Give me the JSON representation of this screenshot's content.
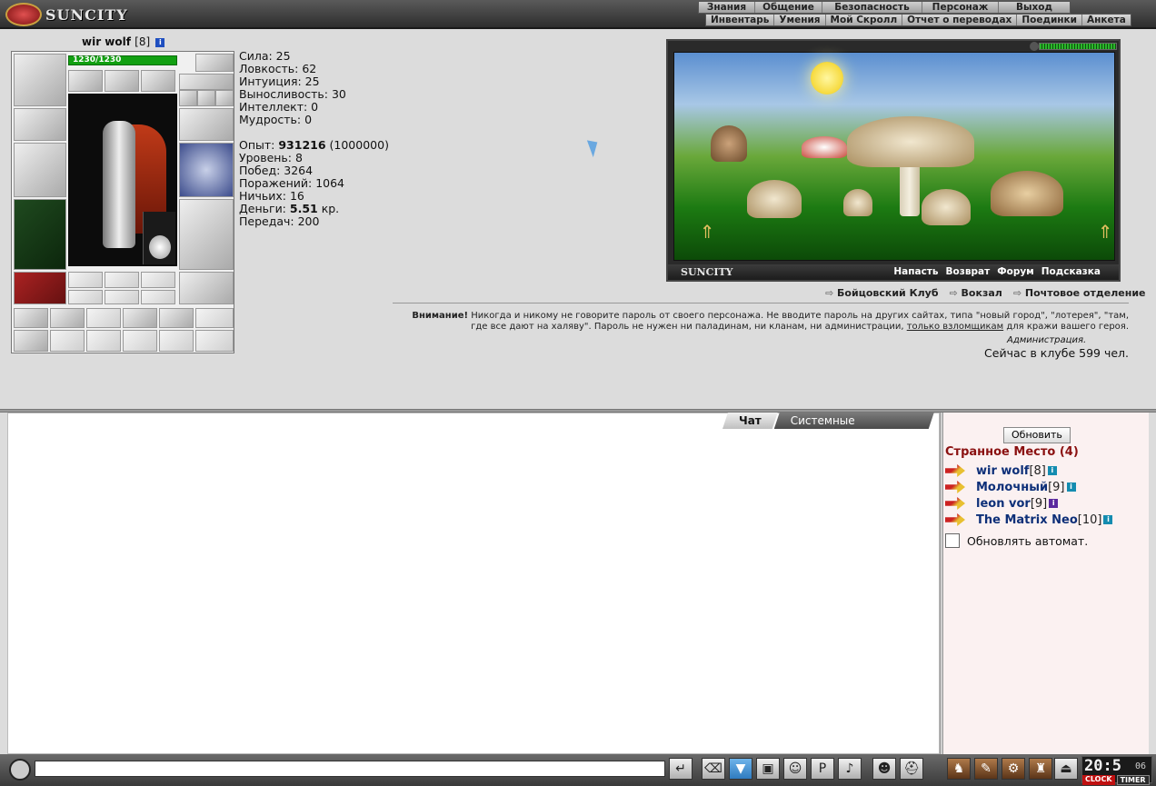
{
  "logo": {
    "text": "SUNCITY"
  },
  "menu_top": [
    "Знания",
    "Общение",
    "Безопасность",
    "Персонаж",
    "Выход"
  ],
  "menu_sub": [
    "Инвентарь",
    "Умения",
    "Мой Скролл",
    "Отчет о переводах",
    "Поединки",
    "Анкета"
  ],
  "character": {
    "name": "wir wolf",
    "level": "[8]",
    "hp": "1230/1230",
    "hp_fraction": 1.0
  },
  "stats": {
    "strength": "Сила: 25",
    "agility": "Ловкость: 62",
    "intuition": "Интуиция: 25",
    "endurance": "Выносливость: 30",
    "intellect": "Интеллект: 0",
    "wisdom": "Мудрость: 0",
    "exp_label": "Опыт: ",
    "exp_value": "931216",
    "exp_next": " (1000000)",
    "level": "Уровень: 8",
    "wins": "Побед: 3264",
    "losses": "Поражений: 1064",
    "draws": "Ничьих: 16",
    "money_label": "Деньги: ",
    "money_value": "5.51",
    "money_unit": " кр.",
    "transfers": "Передач: 200"
  },
  "location": {
    "name": "SUNCITY",
    "links": [
      "Напасть",
      "Возврат",
      "Форум",
      "Подсказка"
    ],
    "exits": [
      "Бойцовский Клуб",
      "Вокзал",
      "Почтовое отделение"
    ]
  },
  "warning": {
    "bold": "Внимание!",
    "text1": " Никогда и никому не говорите пароль от своего персонажа. Не вводите пароль на других сайтах, типа \"новый город\", \"лотерея\", \"там, где все дают на халяву\". Пароль не нужен ни паладинам, ни кланам, ни администрации, ",
    "underline": "только взломщикам",
    "text2": " для кражи вашего героя.",
    "signature": "Администрация."
  },
  "online": "Сейчас в клубе 599 чел.",
  "chat": {
    "tabs": [
      "Чат",
      "Системные сообщения"
    ],
    "input_value": ""
  },
  "sidebar": {
    "refresh_label": "Обновить",
    "place": "Странное Место (4)",
    "users": [
      {
        "name": "wir wolf",
        "level": "[8]"
      },
      {
        "name": "Молочный",
        "level": "[9]"
      },
      {
        "name": "leon vor",
        "level": "[9]"
      },
      {
        "name": "The Matrix Neo",
        "level": "[10]"
      }
    ],
    "auto_label": "Обновлять автомат."
  },
  "clock": {
    "time": "20:5",
    "seconds": "06",
    "label_clock": "CLOCK",
    "label_timer": "TIMER"
  },
  "colors": {
    "accent_place": "#8a1010",
    "user_name": "#0d2f78",
    "hp_green": "#12a012"
  }
}
